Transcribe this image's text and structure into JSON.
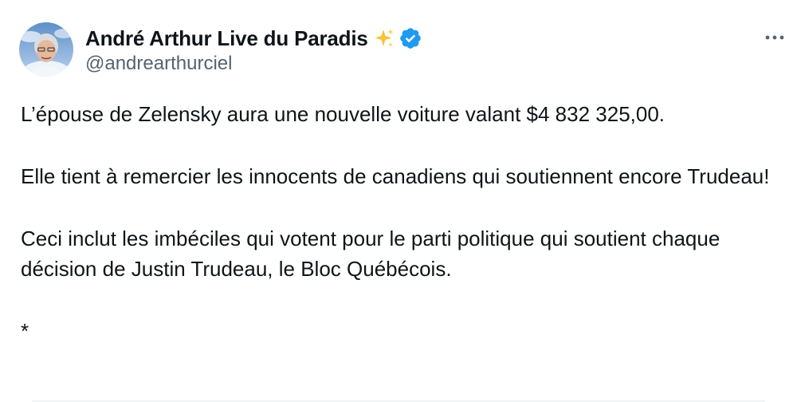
{
  "author": {
    "display_name": "André Arthur Live du Paradis",
    "handle": "@andrearthurciel",
    "verified": true,
    "name_emoji_icon": "sparkles-icon",
    "verified_icon": "verified-badge-icon",
    "verified_color": "#1d9bf0"
  },
  "menu": {
    "more_icon": "more-horizontal-icon"
  },
  "tweet": {
    "paragraph_1": "L’épouse de Zelensky aura une nouvelle voiture valant $4 832 325,00.",
    "paragraph_2": "Elle tient à remercier les innocents de canadiens qui soutiennent encore Trudeau!",
    "paragraph_3": "Ceci inclut les imbéciles qui votent pour le parti politique qui soutient chaque décision de Justin Trudeau, le Bloc Québécois.",
    "paragraph_4": "*"
  },
  "colors": {
    "text_primary": "#0f1419",
    "text_secondary": "#536471",
    "accent": "#1d9bf0",
    "sparkle": "#f7c23a"
  }
}
